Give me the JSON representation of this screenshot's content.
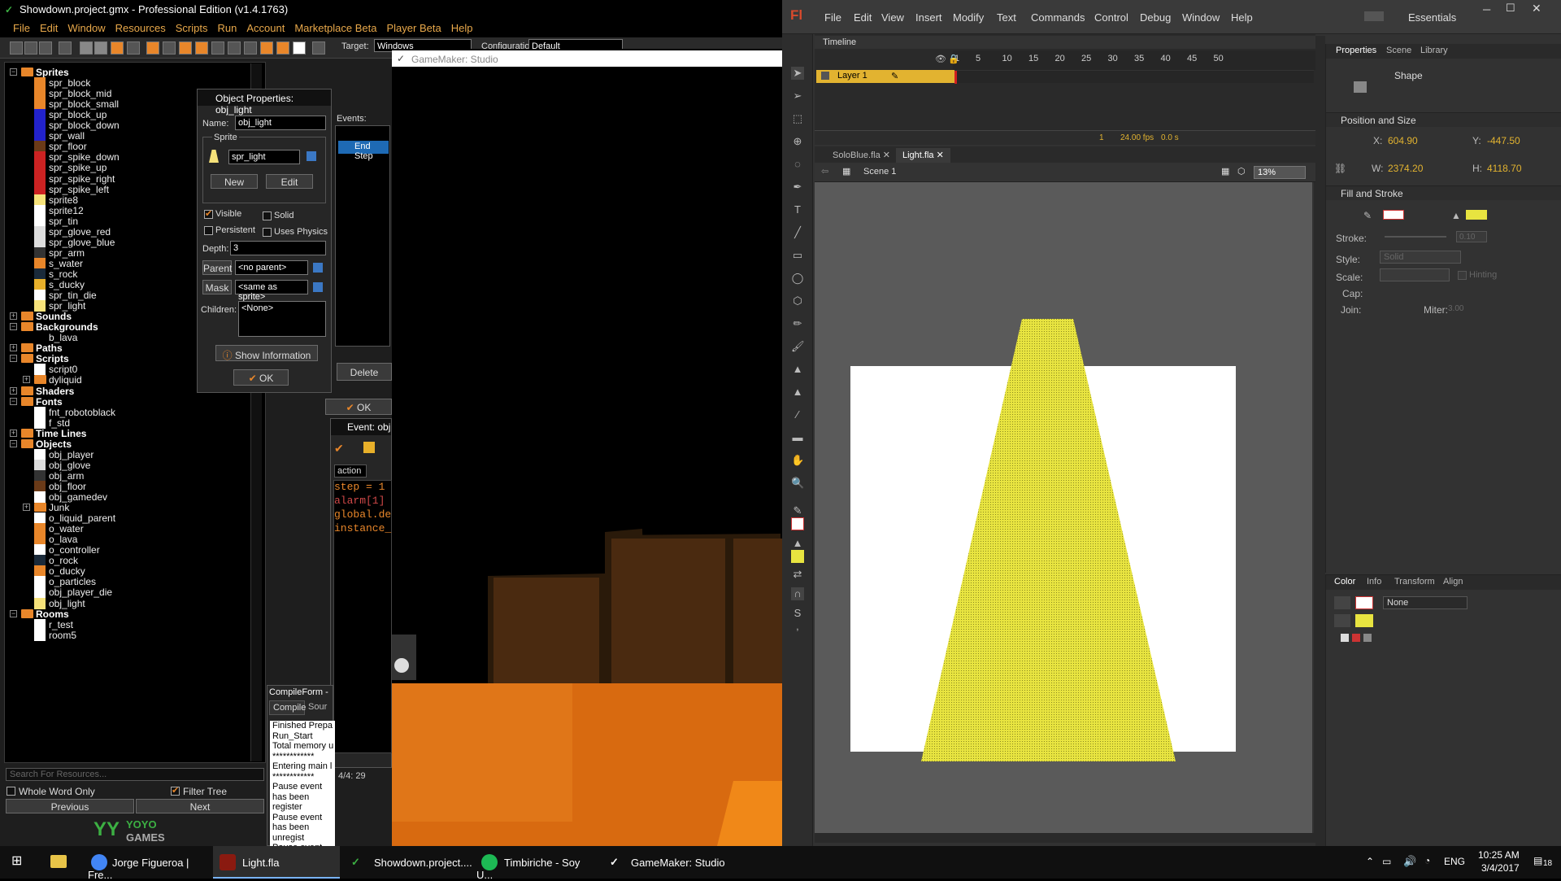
{
  "gm": {
    "title": "Showdown.project.gmx - Professional Edition (v1.4.1763)",
    "menu": [
      "File",
      "Edit",
      "Window",
      "Resources",
      "Scripts",
      "Run",
      "Account",
      "Marketplace Beta",
      "Player Beta",
      "Help"
    ],
    "target_label": "Target:",
    "target_value": "Windows",
    "config_label": "Configuration:",
    "config_value": "Default",
    "tree": [
      {
        "type": "cat",
        "label": "Sprites",
        "open": true
      },
      {
        "type": "item",
        "label": "spr_block",
        "color": "#e8862a"
      },
      {
        "type": "item",
        "label": "spr_block_mid",
        "color": "#e8862a"
      },
      {
        "type": "item",
        "label": "spr_block_small",
        "color": "#e8862a"
      },
      {
        "type": "item",
        "label": "spr_block_up",
        "color": "#2222cc"
      },
      {
        "type": "item",
        "label": "spr_block_down",
        "color": "#2222cc"
      },
      {
        "type": "item",
        "label": "spr_wall",
        "color": "#2222cc"
      },
      {
        "type": "item",
        "label": "spr_floor",
        "color": "#6a3a18"
      },
      {
        "type": "item",
        "label": "spr_spike_down",
        "color": "#cc2222"
      },
      {
        "type": "item",
        "label": "spr_spike_up",
        "color": "#cc2222"
      },
      {
        "type": "item",
        "label": "spr_spike_right",
        "color": "#cc2222"
      },
      {
        "type": "item",
        "label": "spr_spike_left",
        "color": "#cc2222"
      },
      {
        "type": "item",
        "label": "sprite8",
        "color": "#f6e27a"
      },
      {
        "type": "item",
        "label": "sprite12",
        "color": "#ffffff"
      },
      {
        "type": "item",
        "label": "spr_tin",
        "color": "#ffffff"
      },
      {
        "type": "item",
        "label": "spr_glove_red",
        "color": "#dddddd"
      },
      {
        "type": "item",
        "label": "spr_glove_blue",
        "color": "#dddddd"
      },
      {
        "type": "item",
        "label": "spr_arm",
        "color": "#333333"
      },
      {
        "type": "item",
        "label": "s_water",
        "color": "#e8862a"
      },
      {
        "type": "item",
        "label": "s_rock",
        "color": "#1a2a3a"
      },
      {
        "type": "item",
        "label": "s_ducky",
        "color": "#e8b02a"
      },
      {
        "type": "item",
        "label": "spr_tin_die",
        "color": "#ffffff"
      },
      {
        "type": "item",
        "label": "spr_light",
        "color": "#f6e27a"
      },
      {
        "type": "cat",
        "label": "Sounds",
        "open": false
      },
      {
        "type": "cat",
        "label": "Backgrounds",
        "open": true
      },
      {
        "type": "item",
        "label": "b_lava",
        "color": ""
      },
      {
        "type": "cat",
        "label": "Paths",
        "open": false
      },
      {
        "type": "cat",
        "label": "Scripts",
        "open": true
      },
      {
        "type": "item",
        "label": "script0",
        "color": "#ffffff"
      },
      {
        "type": "sub",
        "label": "dyliquid"
      },
      {
        "type": "cat",
        "label": "Shaders",
        "open": false
      },
      {
        "type": "cat",
        "label": "Fonts",
        "open": true
      },
      {
        "type": "item",
        "label": "fnt_robotoblack",
        "color": "#ffffff"
      },
      {
        "type": "item",
        "label": "f_std",
        "color": "#ffffff"
      },
      {
        "type": "cat",
        "label": "Time Lines",
        "open": false
      },
      {
        "type": "cat",
        "label": "Objects",
        "open": true
      },
      {
        "type": "item",
        "label": "obj_player",
        "color": "#ffffff"
      },
      {
        "type": "item",
        "label": "obj_glove",
        "color": "#dddddd"
      },
      {
        "type": "item",
        "label": "obj_arm",
        "color": "#333333"
      },
      {
        "type": "item",
        "label": "obj_floor",
        "color": "#6a3a18"
      },
      {
        "type": "item",
        "label": "obj_gamedev",
        "color": "#ffffff"
      },
      {
        "type": "sub",
        "label": "Junk"
      },
      {
        "type": "item",
        "label": "o_liquid_parent",
        "color": "#ffffff"
      },
      {
        "type": "item",
        "label": "o_water",
        "color": "#e8862a"
      },
      {
        "type": "item",
        "label": "o_lava",
        "color": "#e8862a"
      },
      {
        "type": "item",
        "label": "o_controller",
        "color": "#ffffff"
      },
      {
        "type": "item",
        "label": "o_rock",
        "color": "#1a2a3a"
      },
      {
        "type": "item",
        "label": "o_ducky",
        "color": "#e8862a"
      },
      {
        "type": "item",
        "label": "o_particles",
        "color": "#ffffff"
      },
      {
        "type": "item",
        "label": "obj_player_die",
        "color": "#ffffff"
      },
      {
        "type": "item",
        "label": "obj_light",
        "color": "#f6e27a"
      },
      {
        "type": "cat",
        "label": "Rooms",
        "open": true
      },
      {
        "type": "item",
        "label": "r_test",
        "color": "#ffffff"
      },
      {
        "type": "item",
        "label": "room5",
        "color": "#ffffff"
      }
    ],
    "search_placeholder": "Search For Resources...",
    "whole_word": "Whole Word Only",
    "filter_tree": "Filter Tree",
    "prev": "Previous",
    "next": "Next",
    "logo_line1": "YOYO",
    "logo_line2": "GAMES"
  },
  "objwin": {
    "title": "Object Properties: obj_light",
    "name_label": "Name:",
    "name_value": "obj_light",
    "sprite_group": "Sprite",
    "sprite_value": "spr_light",
    "new_btn": "New",
    "edit_btn": "Edit",
    "visible": "Visible",
    "solid": "Solid",
    "persistent": "Persistent",
    "uses_physics": "Uses Physics",
    "depth_label": "Depth:",
    "depth_value": "3",
    "parent_btn": "Parent",
    "parent_value": "<no parent>",
    "mask_btn": "Mask",
    "mask_value": "<same as sprite>",
    "children_label": "Children:",
    "children_value": "<None>",
    "show_info": "Show Information",
    "ok": "OK",
    "events_label": "Events:",
    "event_item": "End Step",
    "delete_btn": "Delete",
    "ok2": "OK"
  },
  "eventwin": {
    "title": "Event: obj",
    "tab": "action",
    "code": [
      "step = 1",
      "alarm[1]",
      "global.de",
      "instance_"
    ],
    "status": "4/4: 29"
  },
  "compile": {
    "title": "CompileForm -",
    "tab1": "Compile",
    "tab2": "Sour",
    "lines": [
      "Finished Prepa",
      "Run_Start",
      "Total memory u",
      "************",
      "Entering main l",
      "************",
      "Pause event has been register",
      "Pause event has been unregist",
      "Pause event has been register",
      "Pause event has been unregist"
    ]
  },
  "game": {
    "title": "GameMaker: Studio"
  },
  "flash": {
    "logo": "Fl",
    "menu": [
      "File",
      "Edit",
      "View",
      "Insert",
      "Modify",
      "Text",
      "Commands",
      "Control",
      "Debug",
      "Window",
      "Help"
    ],
    "workspace": "Essentials",
    "timeline_tab": "Timeline",
    "ruler": [
      "1",
      "5",
      "10",
      "15",
      "20",
      "25",
      "30",
      "35",
      "40",
      "45",
      "50"
    ],
    "layer": "Layer 1",
    "frame": "1",
    "fps": "24.00 fps",
    "time": "0.0 s",
    "docs": [
      "SoloBlue.fla",
      "Light.fla"
    ],
    "scene": "Scene 1",
    "zoom": "13%",
    "panel_tabs": [
      "Properties",
      "Scene",
      "Library"
    ],
    "shape": "Shape",
    "pos_section": "Position and Size",
    "x_label": "X:",
    "x_value": "604.90",
    "y_label": "Y:",
    "y_value": "-447.50",
    "w_label": "W:",
    "w_value": "2374.20",
    "h_label": "H:",
    "h_value": "4118.70",
    "fill_section": "Fill and Stroke",
    "stroke_label": "Stroke:",
    "stroke_value": "0.10",
    "style_label": "Style:",
    "style_value": "Solid",
    "scale_label": "Scale:",
    "hinting": "Hinting",
    "cap_label": "Cap:",
    "join_label": "Join:",
    "miter_label": "Miter:",
    "miter_value": "3.00",
    "color_tabs": [
      "Color",
      "Info",
      "Transform",
      "Align"
    ],
    "color_type": "None",
    "fill_color": "#e8e440"
  },
  "taskbar": {
    "items": [
      "Jorge Figueroa | Fre...",
      "Light.fla",
      "Showdown.project....",
      "Timbiriche - Soy U...",
      "GameMaker: Studio"
    ],
    "lang": "ENG",
    "time": "10:25 AM",
    "date": "3/4/2017",
    "notif": "18"
  }
}
